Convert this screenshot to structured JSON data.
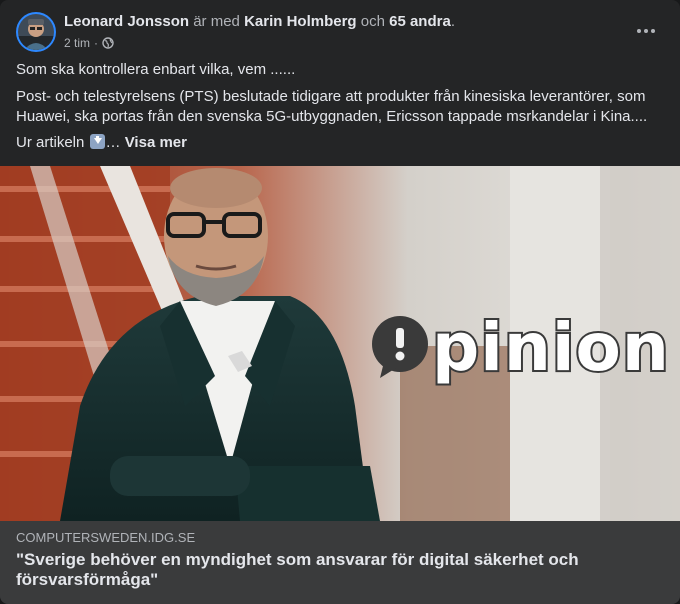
{
  "post": {
    "author": "Leonard Jonsson",
    "with_text": "är med",
    "tagged": "Karin Holmberg",
    "and_text": "och",
    "others": "65 andra",
    "period": ".",
    "time": "2 tim",
    "dot": "·",
    "privacy_icon": "globe-icon",
    "more_icon": "more-horizontal-icon",
    "paragraph1": "Som ska kontrollera enbart vilka, vem ......",
    "paragraph2": "Post- och telestyrelsens (PTS) beslutade tidigare att produkter från kinesiska leverantörer, som Huawei, ska portas från den svenska 5G-utbyggnaden,  Ericsson tappade msrkandelar i Kina....",
    "paragraph3_prefix": "Ur artikeln",
    "paragraph3_emoji": "down-arrow-emoji",
    "paragraph3_ellipsis": "…",
    "see_more": "Visa mer"
  },
  "image": {
    "overlay_text": "pinion"
  },
  "link": {
    "domain": "COMPUTERSWEDEN.IDG.SE",
    "headline": "\"Sverige behöver en myndighet som ansvarar för digital säkerhet och försvarsförmåga\""
  },
  "colors": {
    "background": "#18191a",
    "card": "#242526",
    "link_box": "#3a3b3c",
    "primary_text": "#e4e6eb",
    "secondary_text": "#b0b3b8",
    "accent": "#2d88ff"
  }
}
